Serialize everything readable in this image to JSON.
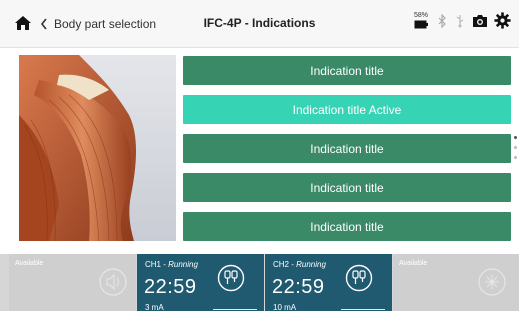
{
  "header": {
    "back_label": "Body part selection",
    "title": "IFC-4P - Indications",
    "battery_percent": "58%",
    "icons": [
      "home-icon",
      "chevron-left-icon",
      "battery-icon",
      "bluetooth-icon",
      "usb-icon",
      "camera-icon",
      "gear-icon"
    ]
  },
  "image": {
    "subject": "shoulder-muscles-illustration"
  },
  "indications": [
    {
      "label": "Indication title",
      "active": false
    },
    {
      "label": "Indication title Active",
      "active": true
    },
    {
      "label": "Indication title",
      "active": false
    },
    {
      "label": "Indication title",
      "active": false
    },
    {
      "label": "Indication title",
      "active": false
    }
  ],
  "scroll": {
    "pages": 3,
    "current": 1
  },
  "channels": {
    "left_available": {
      "label": "Available",
      "icon": "speaker-icon"
    },
    "ch1": {
      "name": "CH1 - ",
      "status": "Running",
      "time": "22:59",
      "current": "3 mA",
      "icon": "electrode-pad-icon"
    },
    "ch2": {
      "name": "CH2 - ",
      "status": "Running",
      "time": "22:59",
      "current": "10 mA",
      "icon": "electrode-pad-icon"
    },
    "right_available": {
      "label": "Available",
      "icon": "sparkle-icon"
    }
  },
  "colors": {
    "indication_button": "#3a8a68",
    "indication_active": "#36d3b4",
    "channel_running": "#1f5a71",
    "slot_available": "#cfcfcf"
  }
}
